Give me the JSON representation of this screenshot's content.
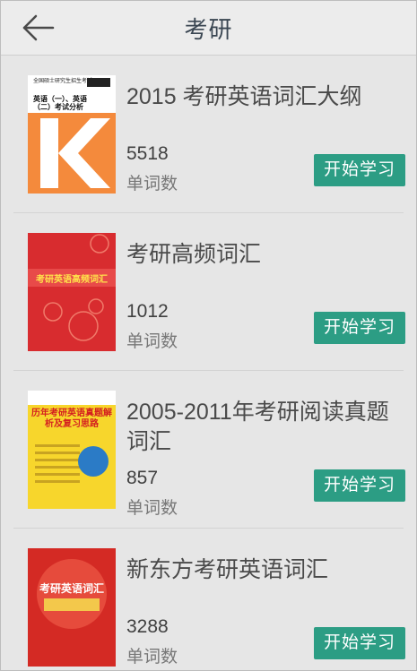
{
  "nav": {
    "title": "考研",
    "back_icon": "arrow-left-icon"
  },
  "colors": {
    "button_bg": "#2c9d84",
    "nav_bg": "#ececec",
    "page_bg": "#e6e6e6"
  },
  "books": [
    {
      "title": "2015 考研英语词汇大纲",
      "count": "5518",
      "count_label": "单词数",
      "button_label": "开始学习",
      "cover_text": "全国硕士研究生招生考试",
      "cover_title": "英语（一）、英语（二）考试分析",
      "cover_big": "K"
    },
    {
      "title": "考研高频词汇",
      "count": "1012",
      "count_label": "单词数",
      "button_label": "开始学习",
      "cover_text": "考研英语高频词汇"
    },
    {
      "title": "2005-2011年考研阅读真题词汇",
      "count": "857",
      "count_label": "单词数",
      "button_label": "开始学习",
      "cover_text": "历年考研英语真题解析及复习思路"
    },
    {
      "title": "新东方考研英语词汇",
      "count": "3288",
      "count_label": "单词数",
      "button_label": "开始学习",
      "cover_text": "考研英语词汇"
    }
  ]
}
